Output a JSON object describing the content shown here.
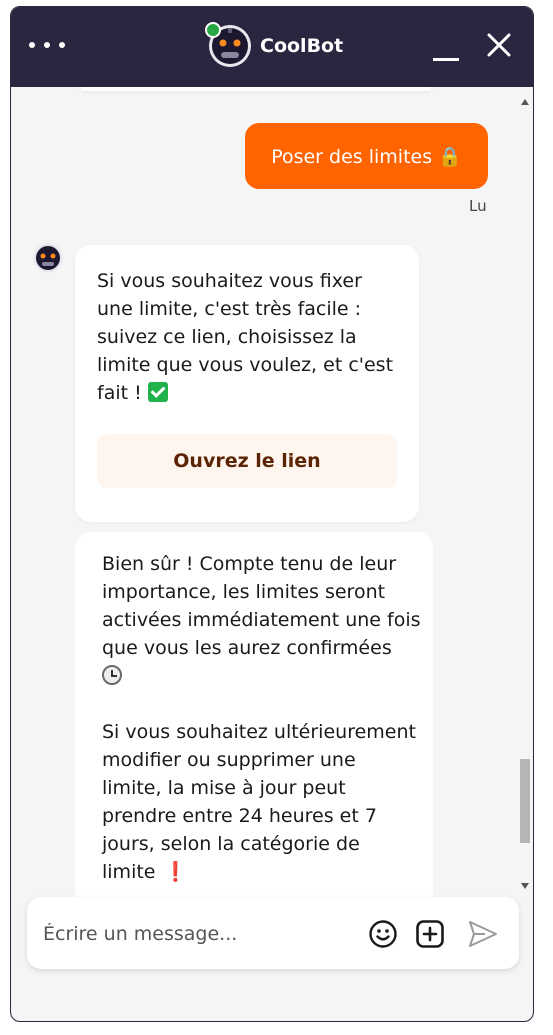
{
  "header": {
    "bot_name": "CoolBot",
    "menu_icon": "more-dots-icon",
    "minimize_icon": "minimize-icon",
    "close_icon": "close-icon"
  },
  "chat": {
    "user_message": "Poser des limites 🔒",
    "read_status": "Lu",
    "bot_message_1": "Si vous souhaitez vous fixer\nune limite, c'est très facile :\nsuivez ce lien, choisissez la\nlimite que vous voulez, et c'est\nfait !",
    "link_button": "Ouvrez le lien",
    "bot_message_2": "Bien sûr ! Compte tenu de leur\nimportance, les limites seront\nactivées immédiatement une fois\nque vous les aurez confirmées\n",
    "bot_message_3": "\n\nSi vous souhaitez ultérieurement\nmodifier ou supprimer une\nlimite, la mise à jour peut\nprendre entre 24 heures et 7\njours, selon la catégorie de\nlimite",
    "exclamation": "❗"
  },
  "composer": {
    "placeholder": "Écrire un message...",
    "emoji_icon": "smiley-icon",
    "add_icon": "add-square-icon",
    "send_icon": "send-icon"
  },
  "colors": {
    "header_bg": "#2b2540",
    "accent": "#ff6400",
    "link_bg": "#fff5ef",
    "link_text": "#5a2405",
    "online": "#27a644"
  }
}
